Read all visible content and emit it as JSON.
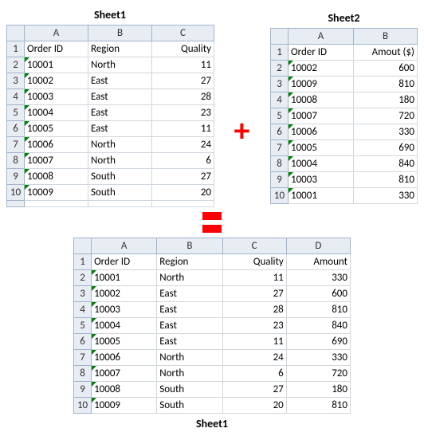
{
  "labels": {
    "sheet1": "Sheet1",
    "sheet2": "Sheet2"
  },
  "colLetters": [
    "A",
    "B",
    "C",
    "D"
  ],
  "sheet1_top": {
    "headers": [
      "Order ID",
      "Region",
      "Quality"
    ],
    "rows": [
      [
        "10001",
        "North",
        "11"
      ],
      [
        "10002",
        "East",
        "27"
      ],
      [
        "10003",
        "East",
        "28"
      ],
      [
        "10004",
        "East",
        "23"
      ],
      [
        "10005",
        "East",
        "11"
      ],
      [
        "10006",
        "North",
        "24"
      ],
      [
        "10007",
        "North",
        "6"
      ],
      [
        "10008",
        "South",
        "27"
      ],
      [
        "10009",
        "South",
        "20"
      ]
    ]
  },
  "sheet2": {
    "headers": [
      "Order ID",
      "Amout ($)"
    ],
    "rows": [
      [
        "10002",
        "600"
      ],
      [
        "10009",
        "810"
      ],
      [
        "10008",
        "180"
      ],
      [
        "10007",
        "720"
      ],
      [
        "10006",
        "330"
      ],
      [
        "10005",
        "690"
      ],
      [
        "10004",
        "840"
      ],
      [
        "10003",
        "810"
      ],
      [
        "10001",
        "330"
      ]
    ]
  },
  "sheet1_bottom": {
    "headers": [
      "Order ID",
      "Region",
      "Quality",
      "Amount"
    ],
    "rows": [
      [
        "10001",
        "North",
        "11",
        "330"
      ],
      [
        "10002",
        "East",
        "27",
        "600"
      ],
      [
        "10003",
        "East",
        "28",
        "810"
      ],
      [
        "10004",
        "East",
        "23",
        "840"
      ],
      [
        "10005",
        "East",
        "11",
        "690"
      ],
      [
        "10006",
        "North",
        "24",
        "330"
      ],
      [
        "10007",
        "North",
        "6",
        "720"
      ],
      [
        "10008",
        "South",
        "27",
        "180"
      ],
      [
        "10009",
        "South",
        "20",
        "810"
      ]
    ]
  }
}
